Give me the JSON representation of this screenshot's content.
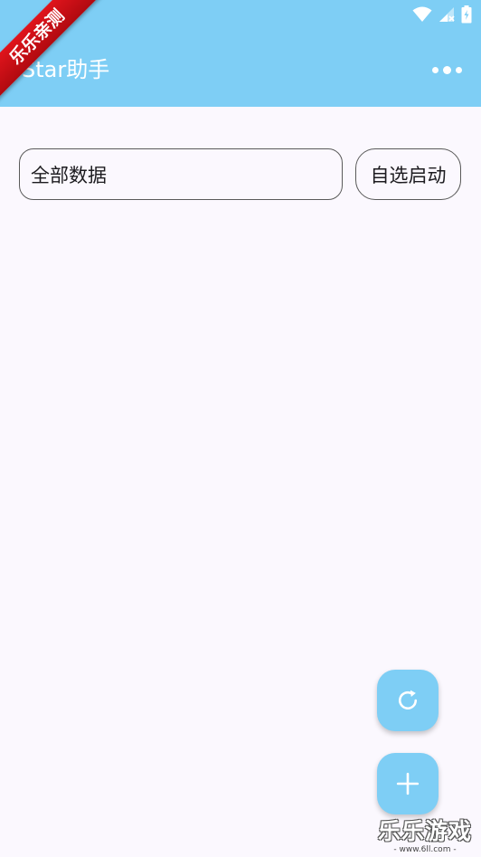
{
  "app_bar": {
    "title": "Star助手",
    "background": "#7ecef5",
    "more_icon": "more-horizontal-icon"
  },
  "status_bar": {
    "icons": [
      "wifi-icon",
      "signal-icon",
      "battery-charging-icon"
    ]
  },
  "ribbon": {
    "text": "乐乐亲测",
    "color": "#d8121a"
  },
  "filter": {
    "selected": "全部数据",
    "auto_start_label": "自选启动"
  },
  "fabs": {
    "refresh_icon": "refresh-icon",
    "add_icon": "plus-icon"
  },
  "watermark": {
    "main": "乐乐游戏",
    "sub": "- www.6ll.com -"
  }
}
